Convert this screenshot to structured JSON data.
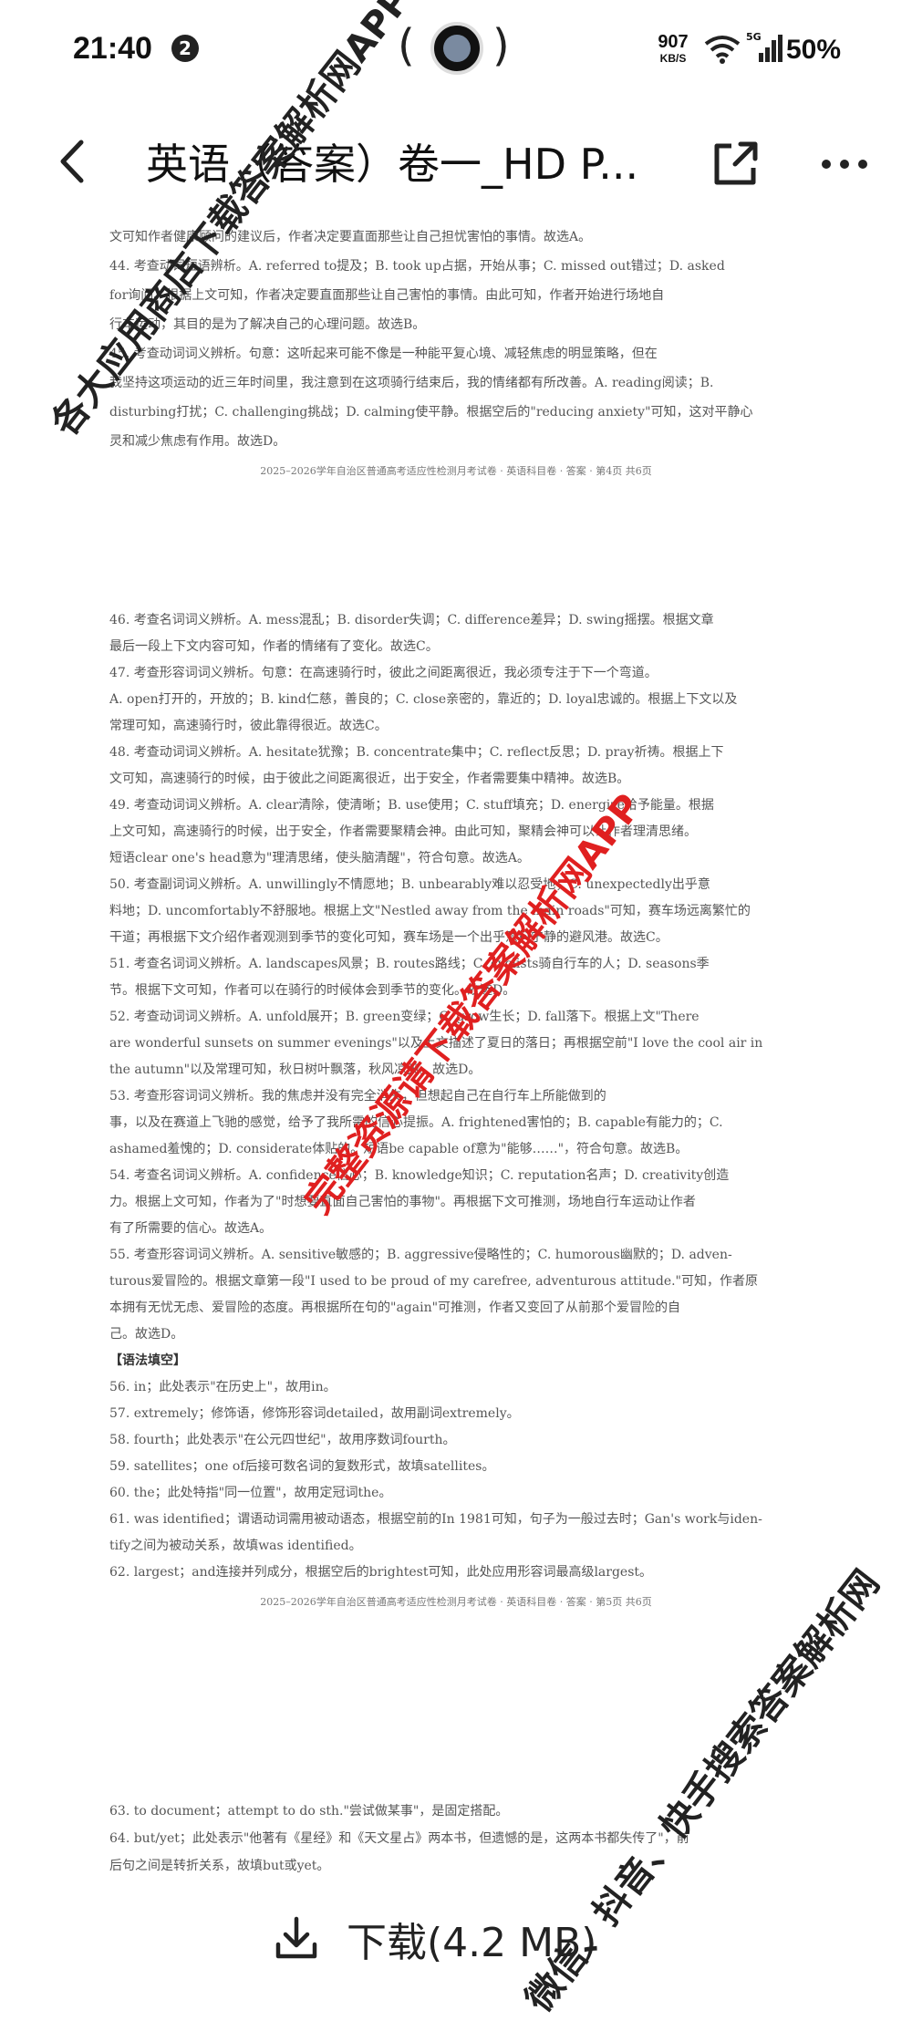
{
  "status_bar": {
    "time": "21:40",
    "notification_count": "2",
    "net_speed_value": "907",
    "net_speed_unit": "KB/S",
    "network_type": "5G",
    "battery": "50%"
  },
  "app_bar": {
    "title": "英语（答案）卷一_HD P..."
  },
  "document": {
    "page_a": [
      "文可知作者健康顾问的建议后，作者决定要直面那些让自己担忧害怕的事情。故选A。",
      "44. 考查动词短语辨析。A. referred to提及；B. took up占据，开始从事；C. missed out错过；D. asked",
      "for询问。根据上文可知，作者决定要直面那些让自己害怕的事情。由此可知，作者开始进行场地自",
      "行车运动，其目的是为了解决自己的心理问题。故选B。",
      "45. 考查动词词义辨析。句意：这听起来可能不像是一种能平复心境、减轻焦虑的明显策略，但在",
      "我坚持这项运动的近三年时间里，我注意到在这项骑行结束后，我的情绪都有所改善。A. reading阅读；B.",
      "disturbing打扰；C. challenging挑战；D. calming使平静。根据空后的\"reducing anxiety\"可知，这对平静心",
      "灵和减少焦虑有作用。故选D。"
    ],
    "footer_a": "2025–2026学年自治区普通高考适应性检测月考试卷 · 英语科目卷 · 答案 · 第4页  共6页",
    "page_b": [
      "46. 考查名词词义辨析。A. mess混乱；B. disorder失调；C. difference差异；D. swing摇摆。根据文章",
      "最后一段上下文内容可知，作者的情绪有了变化。故选C。",
      "47. 考查形容词词义辨析。句意：在高速骑行时，彼此之间距离很近，我必须专注于下一个弯道。",
      "A. open打开的，开放的；B. kind仁慈，善良的；C. close亲密的，靠近的；D. loyal忠诚的。根据上下文以及",
      "常理可知，高速骑行时，彼此靠得很近。故选C。",
      "48. 考查动词词义辨析。A. hesitate犹豫；B. concentrate集中；C. reflect反思；D. pray祈祷。根据上下",
      "文可知，高速骑行的时候，由于彼此之间距离很近，出于安全，作者需要集中精神。故选B。",
      "49. 考查动词词义辨析。A. clear清除，使清晰；B. use使用；C. stuff填充；D. energize给予能量。根据",
      "上文可知，高速骑行的时候，出于安全，作者需要聚精会神。由此可知，聚精会神可以让作者理清思绪。",
      "短语clear one's head意为\"理清思绪，使头脑清醒\"，符合句意。故选A。",
      "50. 考查副词词义辨析。A. unwillingly不情愿地；B. unbearably难以忍受地；C. unexpectedly出乎意",
      "料地；D. uncomfortably不舒服地。根据上文\"Nestled away from the main roads\"可知，赛车场远离繁忙的",
      "干道；再根据下文介绍作者观测到季节的变化可知，赛车场是一个出乎意料宁静的避风港。故选C。",
      "51. 考查名词词义辨析。A. landscapes风景；B. routes路线；C. cyclists骑自行车的人；D. seasons季",
      "节。根据下文可知，作者可以在骑行的时候体会到季节的变化。故选D。",
      "52. 考查动词词义辨析。A. unfold展开；B. green变绿；C. grow生长；D. fall落下。根据上文\"There",
      "are wonderful sunsets on summer evenings\"以及上文描述了夏日的落日；再根据空前\"I love the cool air in",
      "the autumn\"以及常理可知，秋日树叶飘落，秋风凉爽。故选D。",
      "53. 考查形容词词义辨析。我的焦虑并没有完全消失，但想起自己在自行车上所能做到的",
      "事，以及在赛道上飞驰的感觉，给予了我所需的信心提振。A. frightened害怕的；B. capable有能力的；C.",
      "ashamed羞愧的；D. considerate体贴的。短语be capable of意为\"能够……\"，符合句意。故选B。",
      "54. 考查名词词义辨析。A. confidence信心；B. knowledge知识；C. reputation名声；D. creativity创造",
      "力。根据上文可知，作者为了\"时想要直面自己害怕的事物\"。再根据下文可推测，场地自行车运动让作者",
      "有了所需要的信心。故选A。",
      "55. 考查形容词词义辨析。A. sensitive敏感的；B. aggressive侵略性的；C. humorous幽默的；D. adven-",
      "turous爱冒险的。根据文章第一段\"I used to be proud of my carefree, adventurous attitude.\"可知，作者原",
      "本拥有无忧无虑、爱冒险的态度。再根据所在句的\"again\"可推测，作者又变回了从前那个爱冒险的自",
      "己。故选D。",
      "【语法填空】",
      "56. in；此处表示\"在历史上\"，故用in。",
      "57. extremely；修饰语，修饰形容词detailed，故用副词extremely。",
      "58. fourth；此处表示\"在公元四世纪\"，故用序数词fourth。",
      "59. satellites；one of后接可数名词的复数形式，故填satellites。",
      "60. the；此处特指\"同一位置\"，故用定冠词the。",
      "61. was identified；谓语动词需用被动语态，根据空前的In 1981可知，句子为一般过去时；Gan's work与iden-",
      "tify之间为被动关系，故填was identified。",
      "62. largest；and连接并列成分，根据空后的brightest可知，此处应用形容词最高级largest。"
    ],
    "footer_b": "2025–2026学年自治区普通高考适应性检测月考试卷 · 英语科目卷 · 答案 · 第5页  共6页",
    "page_c": [
      "63. to document；attempt to do sth.\"尝试做某事\"，是固定搭配。",
      "64. but/yet；此处表示\"他著有《星经》和《天文星占》两本书，但遗憾的是，这两本书都失传了\"，前",
      "后句之间是转折关系，故填but或yet。"
    ]
  },
  "watermarks": {
    "left": "各大应用商店下载答案解析网APP",
    "center": "完整资源请下载答案解析网APP",
    "right": "微信、抖音、快手搜索答案解析网"
  },
  "download": {
    "label": "下载(4.2 MB)"
  },
  "colors": {
    "watermark_red": "#e02020",
    "text_dark": "#222222"
  },
  "icons": [
    "back-arrow-icon",
    "share-icon",
    "more-icon",
    "download-icon",
    "wifi-icon",
    "signal-icon"
  ]
}
